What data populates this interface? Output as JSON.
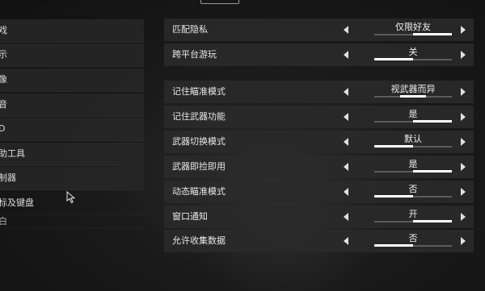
{
  "left_menu": [
    {
      "label": "戏"
    },
    {
      "label": "示"
    },
    {
      "label": "像"
    },
    {
      "label": "音"
    },
    {
      "label": "D"
    },
    {
      "label": "助工具"
    },
    {
      "label": "制器"
    },
    {
      "label": "标及键盘"
    },
    {
      "label": "白"
    }
  ],
  "settings": [
    {
      "label": "匹配隐私",
      "value": "仅限好友",
      "option_index": 1,
      "option_count": 2
    },
    {
      "label": "跨平台游玩",
      "value": "关",
      "option_index": 0,
      "option_count": 2
    },
    {
      "label": "记住瞄准模式",
      "value": "视武器而异",
      "option_index": 1,
      "option_count": 3
    },
    {
      "label": "记住武器功能",
      "value": "是",
      "option_index": 1,
      "option_count": 2
    },
    {
      "label": "武器切换模式",
      "value": "默认",
      "option_index": 0,
      "option_count": 2
    },
    {
      "label": "武器即捡即用",
      "value": "是",
      "option_index": 1,
      "option_count": 2
    },
    {
      "label": "动态瞄准模式",
      "value": "否",
      "option_index": 0,
      "option_count": 2
    },
    {
      "label": "窗口通知",
      "value": "开",
      "option_index": 1,
      "option_count": 2
    },
    {
      "label": "允许收集数据",
      "value": "否",
      "option_index": 0,
      "option_count": 2
    }
  ],
  "icons": {
    "left_arrow": "chevron-left-icon",
    "right_arrow": "chevron-right-icon",
    "cursor": "mouse-cursor-icon"
  },
  "colors": {
    "row_background": "#2a2a2a",
    "indicator_active": "#ffffff",
    "indicator_track": "#5c5c5c"
  }
}
